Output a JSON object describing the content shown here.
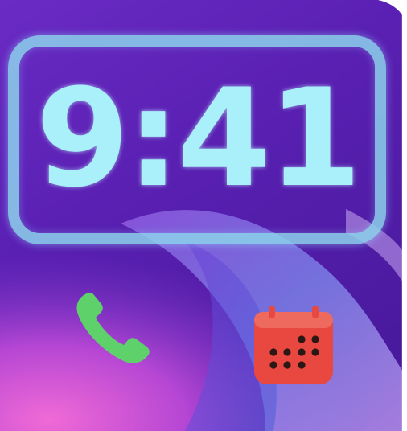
{
  "lock_screen": {
    "time": "9:41"
  },
  "widgets": [
    {
      "icon": "phone-icon",
      "color": "#5fd16a"
    },
    {
      "icon": "calendar-icon",
      "color": "#e8483f"
    }
  ],
  "colors": {
    "wallpaper_purple": "#5a24b8",
    "wallpaper_pink": "#e35fd0",
    "clock_text": "#a9f0fb",
    "frame_glow": "#8cd2eb"
  }
}
